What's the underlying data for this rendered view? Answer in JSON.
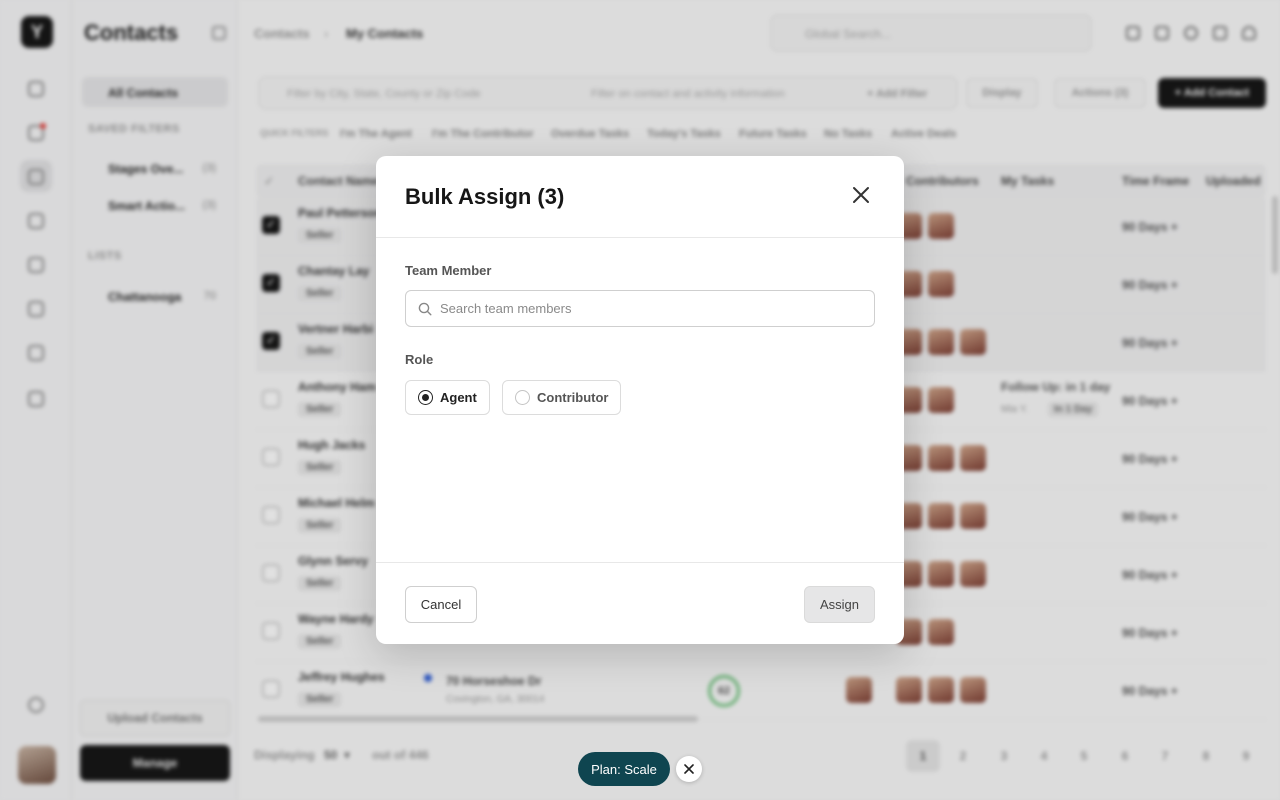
{
  "app": {
    "title": "Contacts",
    "breadcrumb": [
      "Contacts",
      "My Contacts"
    ],
    "global_search_placeholder": "Global Search...",
    "sidebar": {
      "all_contacts": "All Contacts",
      "saved_filters_heading": "SAVED FILTERS",
      "saved_filters": [
        {
          "label": "Stages Ove...",
          "count": "(3)"
        },
        {
          "label": "Smart Actio...",
          "count": "(3)"
        }
      ],
      "lists_heading": "LISTS",
      "lists": [
        {
          "label": "Chattanooga",
          "count": "70"
        }
      ],
      "upload_label": "Upload Contacts",
      "manage_label": "Manage"
    },
    "toolbar": {
      "location_filter_placeholder": "Filter by City, State, County or Zip Code",
      "activity_filter_placeholder": "Filter on contact and activity information",
      "add_filter": "+ Add Filter",
      "display": "Display",
      "actions": "Actions (3)",
      "add_contact": "+ Add Contact"
    },
    "quick_filters": [
      "QUICK FILTERS",
      "I'm The Agent",
      "I'm The Contributor",
      "Overdue Tasks",
      "Today's Tasks",
      "Future Tasks",
      "No Tasks",
      "Active Deals"
    ],
    "table": {
      "headers": [
        "Contact Name",
        "Contributors",
        "My Tasks",
        "Time Frame",
        "Uploaded"
      ],
      "rows": [
        {
          "name": "Paul Petterson",
          "tag": "Seller",
          "selected": true,
          "time_frame": "90 Days +"
        },
        {
          "name": "Chantay Lay",
          "tag": "Seller",
          "selected": true,
          "time_frame": "90 Days +"
        },
        {
          "name": "Vertner Harbi",
          "tag": "Seller",
          "selected": true,
          "time_frame": "90 Days +"
        },
        {
          "name": "Anthony Ham",
          "tag": "Seller",
          "selected": false,
          "time_frame": "90 Days +",
          "task": "Follow Up: in 1 day",
          "task_sub": "Mia Y.",
          "task_badge": "In 1 Day"
        },
        {
          "name": "Hugh Jacks",
          "tag": "Seller",
          "selected": false,
          "time_frame": "90 Days +"
        },
        {
          "name": "Michael Helm",
          "tag": "Seller",
          "selected": false,
          "time_frame": "90 Days +"
        },
        {
          "name": "Glynn Servy",
          "tag": "Seller",
          "selected": false,
          "time_frame": "90 Days +"
        },
        {
          "name": "Wayne Hardy",
          "tag": "Seller",
          "selected": false,
          "time_frame": "90 Days +"
        },
        {
          "name": "Jeffrey Hughes",
          "tag": "Seller",
          "selected": false,
          "time_frame": "90 Days +",
          "address": "70 Horseshoe Dr",
          "address_sub": "Covington, GA, 30014",
          "score": "62"
        }
      ]
    },
    "pagination": {
      "displaying_label": "Displaying",
      "page_size": "50",
      "total_label": "out of 446",
      "pages": [
        "1",
        "2",
        "3",
        "4",
        "5",
        "6",
        "7",
        "8",
        "9"
      ],
      "current": "1"
    }
  },
  "modal": {
    "title": "Bulk Assign (3)",
    "team_member_label": "Team Member",
    "search_placeholder": "Search team members",
    "search_value": "",
    "role_label": "Role",
    "roles": [
      {
        "label": "Agent",
        "selected": true
      },
      {
        "label": "Contributor",
        "selected": false
      }
    ],
    "cancel_label": "Cancel",
    "assign_label": "Assign"
  },
  "plan_pill": {
    "label": "Plan: Scale"
  },
  "colors": {
    "plan_pill_bg": "#0f4550",
    "primary_dark": "#111111"
  }
}
